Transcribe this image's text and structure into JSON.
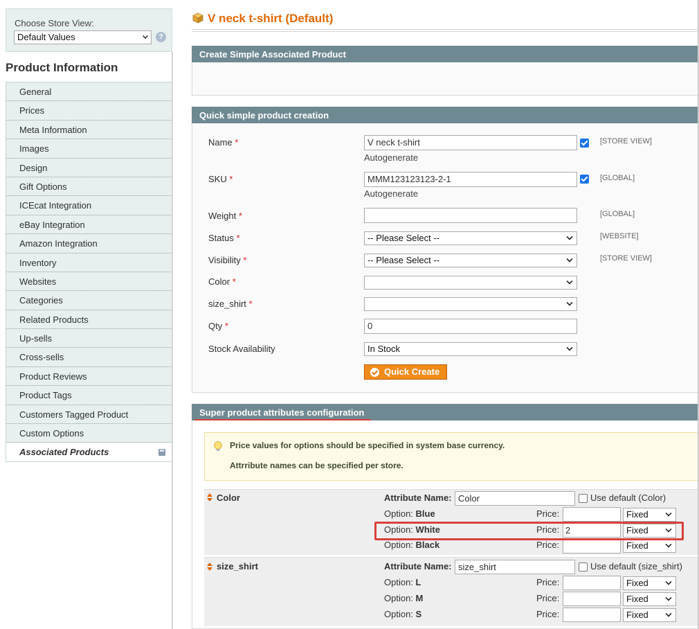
{
  "store_view": {
    "label": "Choose Store View:",
    "selected": "Default Values",
    "help_icon": "help-icon"
  },
  "sidebar": {
    "title": "Product Information",
    "tabs": [
      {
        "label": "General"
      },
      {
        "label": "Prices"
      },
      {
        "label": "Meta Information"
      },
      {
        "label": "Images"
      },
      {
        "label": "Design"
      },
      {
        "label": "Gift Options"
      },
      {
        "label": "ICEcat Integration"
      },
      {
        "label": "eBay Integration"
      },
      {
        "label": "Amazon Integration"
      },
      {
        "label": "Inventory"
      },
      {
        "label": "Websites"
      },
      {
        "label": "Categories"
      },
      {
        "label": "Related Products"
      },
      {
        "label": "Up-sells"
      },
      {
        "label": "Cross-sells"
      },
      {
        "label": "Product Reviews"
      },
      {
        "label": "Product Tags"
      },
      {
        "label": "Customers Tagged Product"
      },
      {
        "label": "Custom Options"
      },
      {
        "label": "Associated Products",
        "active": true
      }
    ]
  },
  "page": {
    "title": "V neck t-shirt (Default)",
    "title_icon": "box-icon",
    "accent_color": "#e26703"
  },
  "create_simple": {
    "heading": "Create Simple Associated Product"
  },
  "quick_create": {
    "heading": "Quick simple product creation",
    "fields": {
      "name": {
        "label": "Name",
        "required": "*",
        "value": "V  neck t-shirt",
        "autogenerate": "Autogenerate",
        "scope": "[STORE VIEW]"
      },
      "sku": {
        "label": "SKU",
        "required": "*",
        "value": "MMM123123123-2-1",
        "autogenerate": "Autogenerate",
        "scope": "[GLOBAL]"
      },
      "weight": {
        "label": "Weight",
        "required": "*",
        "value": "",
        "scope": "[GLOBAL]"
      },
      "status": {
        "label": "Status",
        "required": "*",
        "value": "-- Please Select --",
        "scope": "[WEBSITE]"
      },
      "visibility": {
        "label": "Visibility",
        "required": "*",
        "value": "-- Please Select --",
        "scope": "[STORE VIEW]"
      },
      "color": {
        "label": "Color",
        "required": "*",
        "value": ""
      },
      "size_shirt": {
        "label": "size_shirt",
        "required": "*",
        "value": ""
      },
      "qty": {
        "label": "Qty",
        "required": "*",
        "value": "0"
      },
      "stock": {
        "label": "Stock Availability",
        "value": "In Stock"
      }
    },
    "button_label": "Quick Create"
  },
  "super_attributes": {
    "heading": "Super product attributes configuration",
    "notice": [
      "Price values for options should be specified in system base currency.",
      "Attrribute names can be specified per store."
    ],
    "attributes": [
      {
        "name": "Color",
        "attr_label": "Attribute Name:",
        "attr_value": "Color",
        "use_default": "Use default (Color)",
        "options": [
          {
            "prefix": "Option:",
            "name": "Blue",
            "price_label": "Price:",
            "price": "",
            "type": "Fixed"
          },
          {
            "prefix": "Option:",
            "name": "White",
            "price_label": "Price:",
            "price": "2",
            "type": "Fixed"
          },
          {
            "prefix": "Option:",
            "name": "Black",
            "price_label": "Price:",
            "price": "",
            "type": "Fixed"
          }
        ]
      },
      {
        "name": "size_shirt",
        "attr_label": "Attribute Name:",
        "attr_value": "size_shirt",
        "use_default": "Use default (size_shirt)",
        "options": [
          {
            "prefix": "Option:",
            "name": "L",
            "price_label": "Price:",
            "price": "",
            "type": "Fixed"
          },
          {
            "prefix": "Option:",
            "name": "M",
            "price_label": "Price:",
            "price": "",
            "type": "Fixed"
          },
          {
            "prefix": "Option:",
            "name": "S",
            "price_label": "Price:",
            "price": "",
            "type": "Fixed"
          }
        ]
      }
    ]
  },
  "colors": {
    "section_header": "#6f8992",
    "highlight": "#d9413b",
    "button": "#f08c1a"
  }
}
